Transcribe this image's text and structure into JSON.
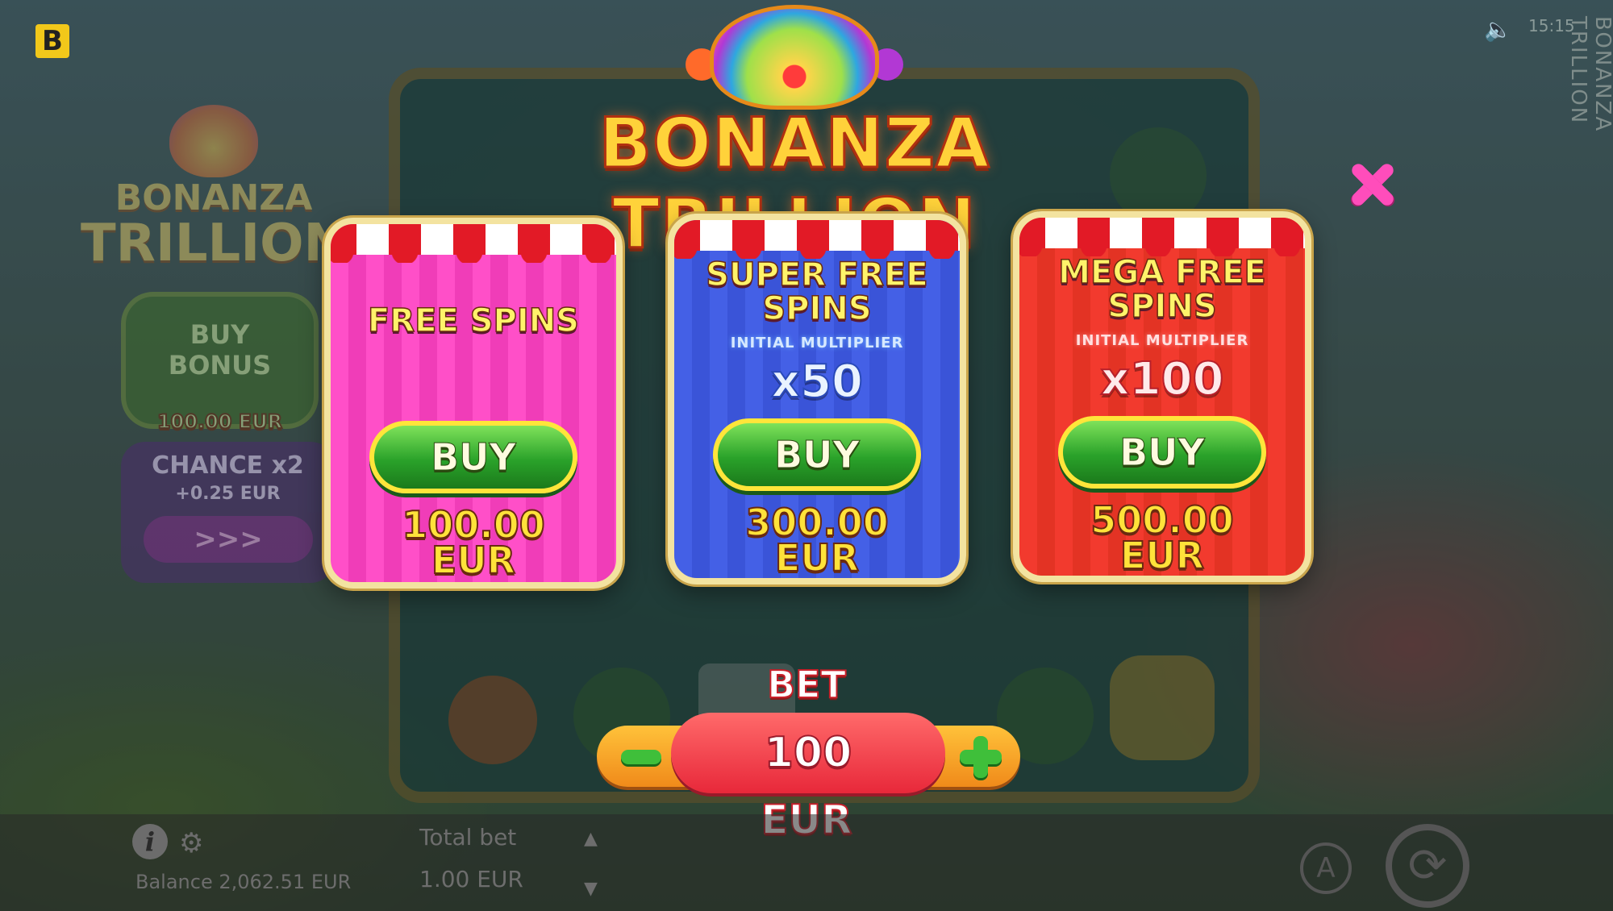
{
  "top_bar": {
    "brand_logo": "B",
    "clock": "15:15",
    "vertical_title": "BONANZA TRILLION",
    "sound_icon": "speaker-icon"
  },
  "main_title": "BONANZA TRILLION",
  "background": {
    "side_logo_line1": "BONANZA",
    "side_logo_line2": "TRILLION",
    "buy_bonus_label": "BUY BONUS",
    "buy_bonus_price": "100.00 EUR",
    "chance_label": "CHANCE x2",
    "chance_sub": "+0.25 EUR",
    "chance_arrows": ">>>"
  },
  "cards": [
    {
      "title": "FREE SPINS",
      "multiplier_label": "",
      "multiplier": "",
      "buy": "BUY",
      "price_amount": "100.00",
      "price_unit": "EUR"
    },
    {
      "title_line1": "SUPER FREE",
      "title_line2": "SPINS",
      "multiplier_label": "INITIAL MULTIPLIER",
      "multiplier": "x50",
      "buy": "BUY",
      "price_amount": "300.00",
      "price_unit": "EUR"
    },
    {
      "title_line1": "MEGA FREE",
      "title_line2": "SPINS",
      "multiplier_label": "INITIAL MULTIPLIER",
      "multiplier": "x100",
      "buy": "BUY",
      "price_amount": "500.00",
      "price_unit": "EUR"
    }
  ],
  "bet": {
    "label": "BET",
    "value": "100",
    "unit": "EUR"
  },
  "bottom_bar": {
    "info": "i",
    "balance": "Balance 2,062.51 EUR",
    "total_bet_label": "Total bet",
    "total_bet_value": "1.00 EUR",
    "autoplay": "A"
  },
  "colors": {
    "pink_card": "#ff4fc8",
    "blue_card": "#4460e6",
    "red_card": "#f23a2e",
    "buy_button": "#2aa22a",
    "close": "#ff4dbb",
    "bet_pill": "#e8283a"
  }
}
